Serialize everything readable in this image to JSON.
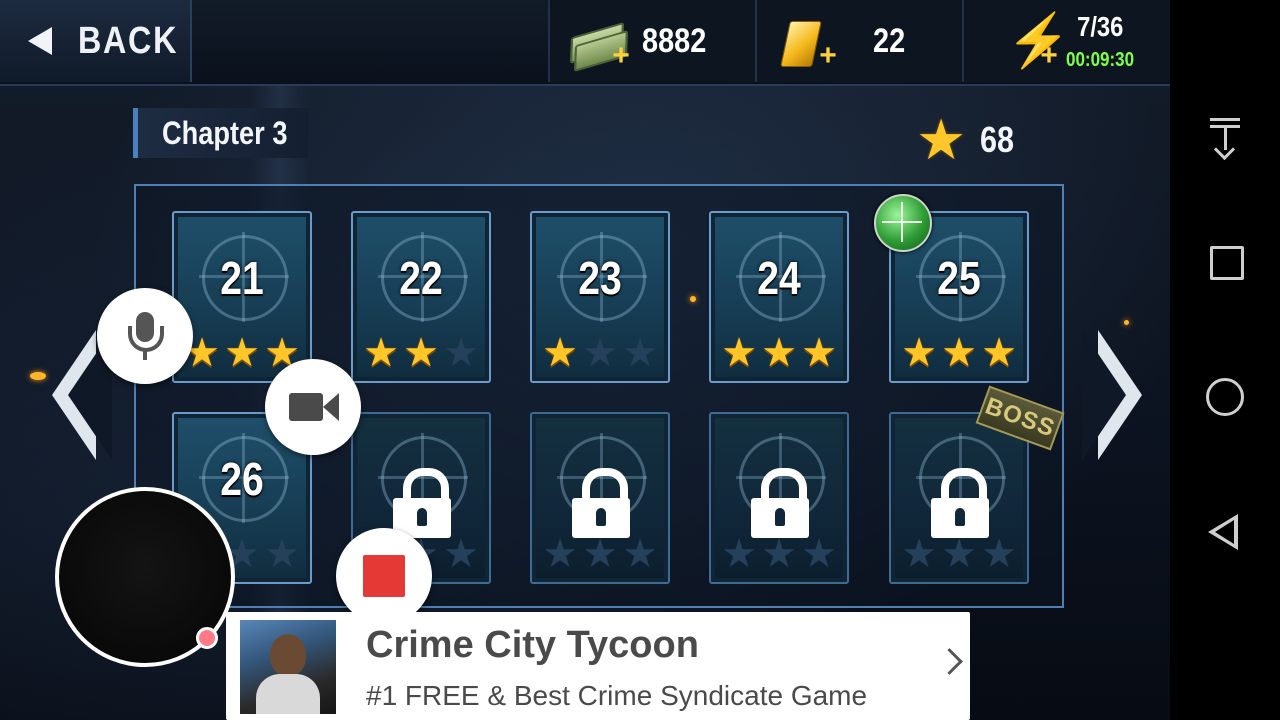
{
  "top_bar": {
    "back_label": "BACK",
    "cash": "8882",
    "gold": "22",
    "energy": "7/36",
    "energy_timer": "00:09:30",
    "cash_icon": "cash-stack-plus-icon",
    "gold_icon": "gold-bar-plus-icon",
    "energy_icon": "lightning-bolt-plus-icon"
  },
  "chapter": {
    "title": "Chapter 3",
    "total_stars": "68"
  },
  "levels": [
    {
      "number": "21",
      "stars": 3,
      "locked": false
    },
    {
      "number": "22",
      "stars": 2,
      "locked": false
    },
    {
      "number": "23",
      "stars": 1,
      "locked": false
    },
    {
      "number": "24",
      "stars": 3,
      "locked": false
    },
    {
      "number": "25",
      "stars": 3,
      "locked": false
    },
    {
      "number": "26",
      "stars": 0,
      "locked": false
    },
    {
      "number": "",
      "stars": 0,
      "locked": true
    },
    {
      "number": "",
      "stars": 0,
      "locked": true
    },
    {
      "number": "",
      "stars": 0,
      "locked": true
    },
    {
      "number": "",
      "stars": 0,
      "locked": true
    }
  ],
  "boss_tag": "BOSS",
  "ad": {
    "title": "Crime City Tycoon",
    "subtitle": "#1 FREE & Best Crime Syndicate Game"
  },
  "colors": {
    "star_on": "#ffc629",
    "star_off": "#25405a",
    "timer_green": "#7dff4a",
    "record_red": "#e53935"
  }
}
